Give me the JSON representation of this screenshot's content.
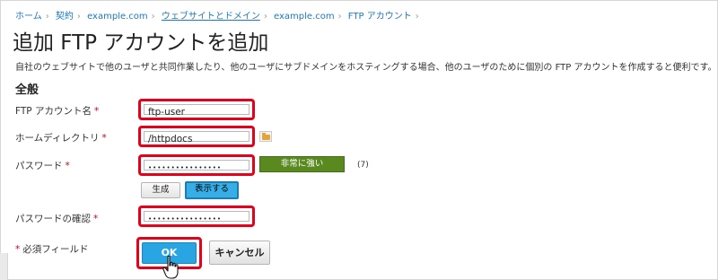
{
  "breadcrumb": [
    "ホーム",
    "契約",
    "example.com",
    "ウェブサイトとドメイン",
    "example.com",
    "FTP アカウント"
  ],
  "page_title": "追加 FTP アカウントを追加",
  "description": "自社のウェブサイトで他のユーザと共同作業したり、他のユーザにサブドメインをホスティングする場合、他のユーザのために個別の FTP アカウントを作成すると便利です。",
  "section_title": "全般",
  "fields": {
    "ftp_account_name": {
      "label": "FTP アカウント名",
      "value": "ftp-user"
    },
    "home_directory": {
      "label": "ホームディレクトリ",
      "value": "/httpdocs"
    },
    "password": {
      "label": "パスワード",
      "value": "••••••••••••••••"
    },
    "password_confirm": {
      "label": "パスワードの確認",
      "value": "••••••••••••••••"
    }
  },
  "required_mark": "*",
  "strength": {
    "label": "非常に強い",
    "score": "(7)",
    "color": "#5a8a1f"
  },
  "buttons": {
    "generate": "生成",
    "show": "表示する",
    "ok": "OK",
    "cancel": "キャンセル"
  },
  "required_note": "必須フィールド",
  "colors": {
    "highlight": "#e6001a",
    "accent": "#2aa5e3",
    "link": "#1c7abf"
  },
  "icons": {
    "folder": "folder-icon",
    "pointer": "hand-pointer-icon"
  }
}
